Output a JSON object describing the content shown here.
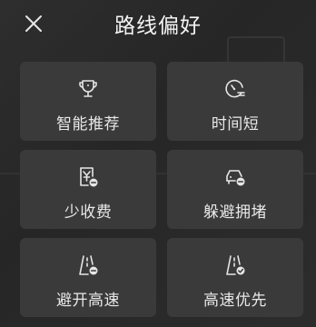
{
  "header": {
    "title": "路线偏好",
    "close_icon": "close-icon"
  },
  "options": [
    {
      "label": "智能推荐",
      "icon": "trophy-icon"
    },
    {
      "label": "时间短",
      "icon": "speedometer-icon"
    },
    {
      "label": "少收费",
      "icon": "no-toll-icon"
    },
    {
      "label": "躲避拥堵",
      "icon": "avoid-congestion-icon"
    },
    {
      "label": "避开高速",
      "icon": "avoid-highway-icon"
    },
    {
      "label": "高速优先",
      "icon": "highway-priority-icon"
    }
  ],
  "colors": {
    "background": "#262626",
    "tile": "#3a3a3a",
    "text": "#e8e8e8"
  }
}
